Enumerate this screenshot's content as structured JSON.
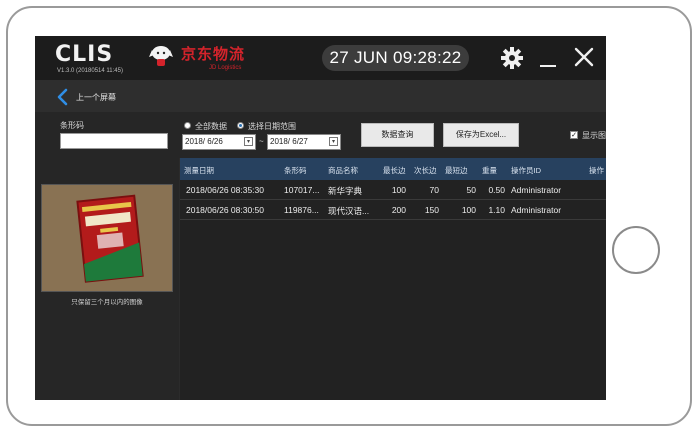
{
  "app": {
    "logo": "CLIS",
    "version": "V1.3.0 (20180514 11:45)",
    "brand": "京东物流",
    "brand_sub": "JD Logistics",
    "clock": "27 JUN 09:28:22"
  },
  "icons": {
    "settings": "gear-icon",
    "minimize": "minimize-icon",
    "close": "close-icon",
    "back": "back-arrow-icon",
    "calendar": "calendar-icon"
  },
  "nav": {
    "back_label": "上一个屏幕"
  },
  "filters": {
    "barcode_label": "条形码",
    "barcode_value": "",
    "radio_all": "全部数据",
    "radio_range": "选择日期范围",
    "radio_selected": "range",
    "date_from": "2018/ 6/26",
    "date_sep": "~",
    "date_to": "2018/ 6/27",
    "query_button": "数据查询",
    "save_button": "保存为Excel...",
    "show_image_label": "显示图像",
    "show_image_checked": "✓"
  },
  "preview": {
    "caption": "只保留三个月以内的图像"
  },
  "table": {
    "columns": [
      "测量日期",
      "条形码",
      "商品名称",
      "最长边",
      "次长边",
      "最短边",
      "重量",
      "操作员ID",
      "操作"
    ],
    "rows": [
      [
        "2018/06/26 08:35:30",
        "107017...",
        "新华字典",
        "100",
        "70",
        "50",
        "0.50",
        "Administrator",
        ""
      ],
      [
        "2018/06/26 08:30:50",
        "119876...",
        "现代汉语...",
        "200",
        "150",
        "100",
        "1.10",
        "Administrator",
        ""
      ]
    ]
  },
  "colors": {
    "brand_red": "#d4232b",
    "header_blue": "#27415f",
    "background": "#2b2b2b"
  }
}
